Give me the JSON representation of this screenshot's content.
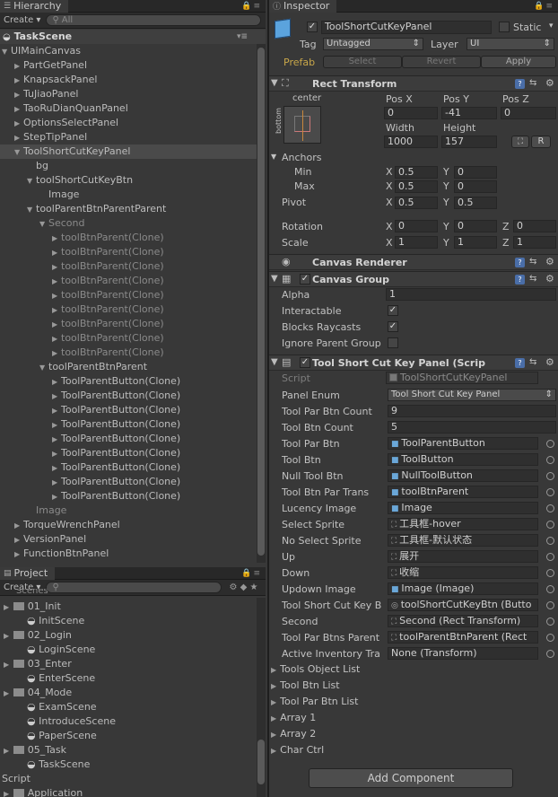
{
  "hierarchy": {
    "tab_title": "Hierarchy",
    "create_label": "Create",
    "search_placeholder": "All",
    "scene_name": "TaskScene",
    "rows": [
      {
        "label": "UIMainCanvas",
        "indent": 0,
        "tri": "▼",
        "style": ""
      },
      {
        "label": "PartGetPanel",
        "indent": 1,
        "tri": "▶",
        "style": ""
      },
      {
        "label": "KnapsackPanel",
        "indent": 1,
        "tri": "▶",
        "style": ""
      },
      {
        "label": "TuJiaoPanel",
        "indent": 1,
        "tri": "▶",
        "style": ""
      },
      {
        "label": "TaoRuDianQuanPanel",
        "indent": 1,
        "tri": "▶",
        "style": ""
      },
      {
        "label": "OptionsSelectPanel",
        "indent": 1,
        "tri": "▶",
        "style": ""
      },
      {
        "label": "StepTipPanel",
        "indent": 1,
        "tri": "▶",
        "style": ""
      },
      {
        "label": "ToolShortCutKeyPanel",
        "indent": 1,
        "tri": "▼",
        "style": "sel"
      },
      {
        "label": "bg",
        "indent": 2,
        "tri": "",
        "style": ""
      },
      {
        "label": "toolShortCutKeyBtn",
        "indent": 2,
        "tri": "▼",
        "style": ""
      },
      {
        "label": "Image",
        "indent": 3,
        "tri": "",
        "style": ""
      },
      {
        "label": "toolParentBtnParentParent",
        "indent": 2,
        "tri": "▼",
        "style": ""
      },
      {
        "label": "Second",
        "indent": 3,
        "tri": "▼",
        "style": "grey"
      },
      {
        "label": "toolBtnParent(Clone)",
        "indent": 4,
        "tri": "▶",
        "style": "grey"
      },
      {
        "label": "toolBtnParent(Clone)",
        "indent": 4,
        "tri": "▶",
        "style": "grey"
      },
      {
        "label": "toolBtnParent(Clone)",
        "indent": 4,
        "tri": "▶",
        "style": "grey"
      },
      {
        "label": "toolBtnParent(Clone)",
        "indent": 4,
        "tri": "▶",
        "style": "grey"
      },
      {
        "label": "toolBtnParent(Clone)",
        "indent": 4,
        "tri": "▶",
        "style": "grey"
      },
      {
        "label": "toolBtnParent(Clone)",
        "indent": 4,
        "tri": "▶",
        "style": "grey"
      },
      {
        "label": "toolBtnParent(Clone)",
        "indent": 4,
        "tri": "▶",
        "style": "grey"
      },
      {
        "label": "toolBtnParent(Clone)",
        "indent": 4,
        "tri": "▶",
        "style": "grey"
      },
      {
        "label": "toolBtnParent(Clone)",
        "indent": 4,
        "tri": "▶",
        "style": "grey"
      },
      {
        "label": "toolParentBtnParent",
        "indent": 3,
        "tri": "▼",
        "style": ""
      },
      {
        "label": "ToolParentButton(Clone)",
        "indent": 4,
        "tri": "▶",
        "style": ""
      },
      {
        "label": "ToolParentButton(Clone)",
        "indent": 4,
        "tri": "▶",
        "style": ""
      },
      {
        "label": "ToolParentButton(Clone)",
        "indent": 4,
        "tri": "▶",
        "style": ""
      },
      {
        "label": "ToolParentButton(Clone)",
        "indent": 4,
        "tri": "▶",
        "style": ""
      },
      {
        "label": "ToolParentButton(Clone)",
        "indent": 4,
        "tri": "▶",
        "style": ""
      },
      {
        "label": "ToolParentButton(Clone)",
        "indent": 4,
        "tri": "▶",
        "style": ""
      },
      {
        "label": "ToolParentButton(Clone)",
        "indent": 4,
        "tri": "▶",
        "style": ""
      },
      {
        "label": "ToolParentButton(Clone)",
        "indent": 4,
        "tri": "▶",
        "style": ""
      },
      {
        "label": "ToolParentButton(Clone)",
        "indent": 4,
        "tri": "▶",
        "style": ""
      },
      {
        "label": "Image",
        "indent": 2,
        "tri": "",
        "style": "grey"
      },
      {
        "label": "TorqueWrenchPanel",
        "indent": 1,
        "tri": "▶",
        "style": ""
      },
      {
        "label": "VersionPanel",
        "indent": 1,
        "tri": "▶",
        "style": ""
      },
      {
        "label": "FunctionBtnPanel",
        "indent": 1,
        "tri": "▶",
        "style": ""
      }
    ]
  },
  "project": {
    "tab_title": "Project",
    "create_label": "Create",
    "cut_label": "Scenes",
    "rows": [
      {
        "label": "01_Init",
        "indent": 0,
        "kind": "folder"
      },
      {
        "label": "InitScene",
        "indent": 1,
        "kind": "scene"
      },
      {
        "label": "02_Login",
        "indent": 0,
        "kind": "folder"
      },
      {
        "label": "LoginScene",
        "indent": 1,
        "kind": "scene"
      },
      {
        "label": "03_Enter",
        "indent": 0,
        "kind": "folder"
      },
      {
        "label": "EnterScene",
        "indent": 1,
        "kind": "scene"
      },
      {
        "label": "04_Mode",
        "indent": 0,
        "kind": "folder"
      },
      {
        "label": "ExamScene",
        "indent": 1,
        "kind": "scene"
      },
      {
        "label": "IntroduceScene",
        "indent": 1,
        "kind": "scene"
      },
      {
        "label": "PaperScene",
        "indent": 1,
        "kind": "scene"
      },
      {
        "label": "05_Task",
        "indent": 0,
        "kind": "folder"
      },
      {
        "label": "TaskScene",
        "indent": 1,
        "kind": "scene"
      },
      {
        "label": "Script",
        "indent": -1,
        "kind": "plain"
      },
      {
        "label": "Application",
        "indent": 0,
        "kind": "folder"
      }
    ]
  },
  "inspector": {
    "tab_title": "Inspector",
    "object_name": "ToolShortCutKeyPanel",
    "static_label": "Static",
    "tag_label": "Tag",
    "tag_value": "Untagged",
    "layer_label": "Layer",
    "layer_value": "UI",
    "prefab_label": "Prefab",
    "select_label": "Select",
    "revert_label": "Revert",
    "apply_label": "Apply",
    "rect": {
      "title": "Rect Transform",
      "anchor_label": "center",
      "side_label": "bottom",
      "pos_x_label": "Pos X",
      "pos_y_label": "Pos Y",
      "pos_z_label": "Pos Z",
      "pos_x": "0",
      "pos_y": "-41",
      "pos_z": "0",
      "width_label": "Width",
      "height_label": "Height",
      "width": "1000",
      "height": "157",
      "r_button": "R",
      "anchors_label": "Anchors",
      "min_label": "Min",
      "max_label": "Max",
      "min_x": "0.5",
      "min_y": "0",
      "max_x": "0.5",
      "max_y": "0",
      "pivot_label": "Pivot",
      "pivot_x": "0.5",
      "pivot_y": "0.5",
      "rotation_label": "Rotation",
      "rot_x": "0",
      "rot_y": "0",
      "rot_z": "0",
      "scale_label": "Scale",
      "scale_x": "1",
      "scale_y": "1",
      "scale_z": "1",
      "x": "X",
      "y": "Y",
      "z": "Z"
    },
    "canvas_renderer_title": "Canvas Renderer",
    "canvas_group": {
      "title": "Canvas Group",
      "alpha_label": "Alpha",
      "alpha": "1",
      "interactable_label": "Interactable",
      "blocks_label": "Blocks Raycasts",
      "ignore_label": "Ignore Parent Group"
    },
    "script": {
      "title": "Tool Short Cut Key Panel (Scrip",
      "script_label": "Script",
      "script_value": "ToolShortCutKeyPanel",
      "fields": [
        {
          "label": "Panel Enum",
          "value": "Tool Short Cut Key Panel",
          "type": "dropdown"
        },
        {
          "label": "Tool Par Btn Count",
          "value": "9",
          "type": "text"
        },
        {
          "label": "Tool Btn Count",
          "value": "5",
          "type": "text"
        },
        {
          "label": "Tool Par Btn",
          "value": "ToolParentButton",
          "type": "obj"
        },
        {
          "label": "Tool Btn",
          "value": "ToolButton",
          "type": "obj"
        },
        {
          "label": "Null Tool Btn",
          "value": "NullToolButton",
          "type": "obj"
        },
        {
          "label": "Tool Btn Par Trans",
          "value": "toolBtnParent",
          "type": "obj"
        },
        {
          "label": "Lucency Image",
          "value": "Image",
          "type": "obj"
        },
        {
          "label": "Select Sprite",
          "value": "工具框-hover",
          "type": "sprite"
        },
        {
          "label": "No Select Sprite",
          "value": "工具框-默认状态",
          "type": "sprite"
        },
        {
          "label": "Up",
          "value": "展开",
          "type": "sprite"
        },
        {
          "label": "Down",
          "value": "收缩",
          "type": "sprite"
        },
        {
          "label": "Updown Image",
          "value": "Image (Image)",
          "type": "obj"
        },
        {
          "label": "Tool Short Cut Key B",
          "value": "toolShortCutKeyBtn (Butto",
          "type": "btn"
        },
        {
          "label": "Second",
          "value": "Second (Rect Transform)",
          "type": "rect"
        },
        {
          "label": "Tool Par Btns Parent",
          "value": "toolParentBtnParent (Rect",
          "type": "rect"
        },
        {
          "label": "Active Inventory Tra",
          "value": "None (Transform)",
          "type": "none"
        }
      ],
      "lists": [
        "Tools Object List",
        "Tool Btn List",
        "Tool Par Btn List",
        "Array 1",
        "Array 2",
        "Char Ctrl"
      ]
    },
    "add_component_label": "Add Component"
  }
}
